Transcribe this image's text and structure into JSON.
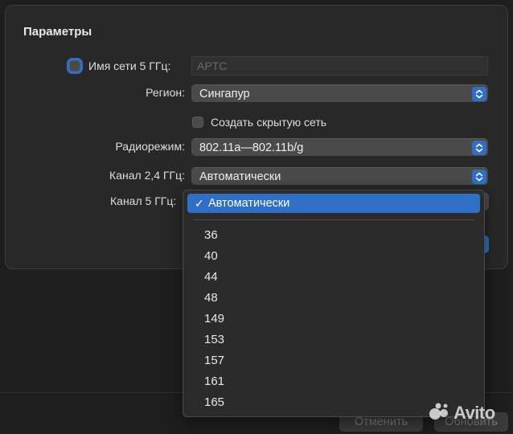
{
  "panel": {
    "title": "Параметры"
  },
  "form": {
    "network_name_5ghz_label": "Имя сети 5 ГГц:",
    "network_name_5ghz_placeholder": "APTC",
    "region_label": "Регион:",
    "region_value": "Сингапур",
    "hidden_network_label": "Создать скрытую сеть",
    "radio_mode_label": "Радиорежим:",
    "radio_mode_value": "802.11a—802.11b/g",
    "channel_24_label": "Канал 2,4 ГГц:",
    "channel_24_value": "Автоматически",
    "channel_5_label": "Канал 5 ГГц:"
  },
  "menu": {
    "checkmark": "✓",
    "selected": "Автоматически",
    "items": [
      "36",
      "40",
      "44",
      "48",
      "149",
      "153",
      "157",
      "161",
      "165"
    ]
  },
  "footer": {
    "cancel_label": "Отменить",
    "update_label": "Обновить"
  },
  "watermark": {
    "text": "Avito",
    "icon": "avito-logo-icon"
  },
  "colors": {
    "accent": "#2f6fc6",
    "background": "#1e1e1e",
    "panel": "#282828",
    "control": "#4a4a4a"
  }
}
